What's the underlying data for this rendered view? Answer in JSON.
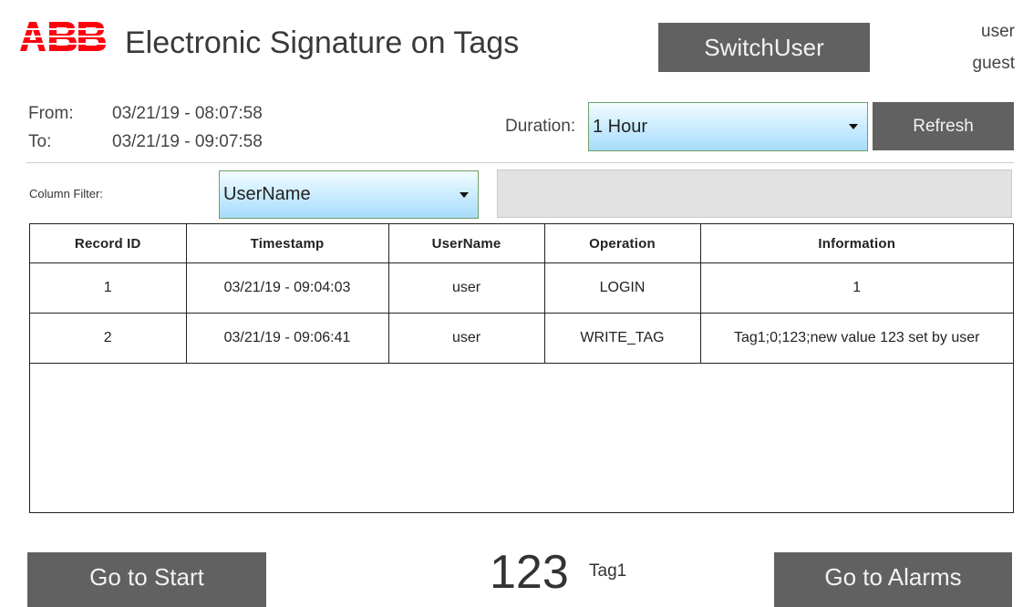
{
  "header": {
    "logo_text": "ABB",
    "title": "Electronic Signature on Tags",
    "switch_user_label": "SwitchUser",
    "user_role": "user",
    "user_name": "guest"
  },
  "time_range": {
    "from_label": "From:",
    "from_value": "03/21/19 - 08:07:58",
    "to_label": "To:",
    "to_value": "03/21/19 - 09:07:58",
    "duration_label": "Duration:",
    "duration_value": "1 Hour",
    "refresh_label": "Refresh"
  },
  "filter": {
    "label": "Column Filter:",
    "column_value": "UserName",
    "text_value": ""
  },
  "table": {
    "columns": [
      "Record ID",
      "Timestamp",
      "UserName",
      "Operation",
      "Information"
    ],
    "rows": [
      [
        "1",
        "03/21/19 - 09:04:03",
        "user",
        "LOGIN",
        "1"
      ],
      [
        "2",
        "03/21/19 - 09:06:41",
        "user",
        "WRITE_TAG",
        "Tag1;0;123;new value 123 set by user"
      ]
    ]
  },
  "footer": {
    "go_start_label": "Go to Start",
    "tag_value": "123",
    "tag_name": "Tag1",
    "go_alarms_label": "Go to Alarms"
  },
  "colors": {
    "brand_red": "#ff000f",
    "button_gray": "#616161",
    "select_blue": "#a7dcfa"
  }
}
